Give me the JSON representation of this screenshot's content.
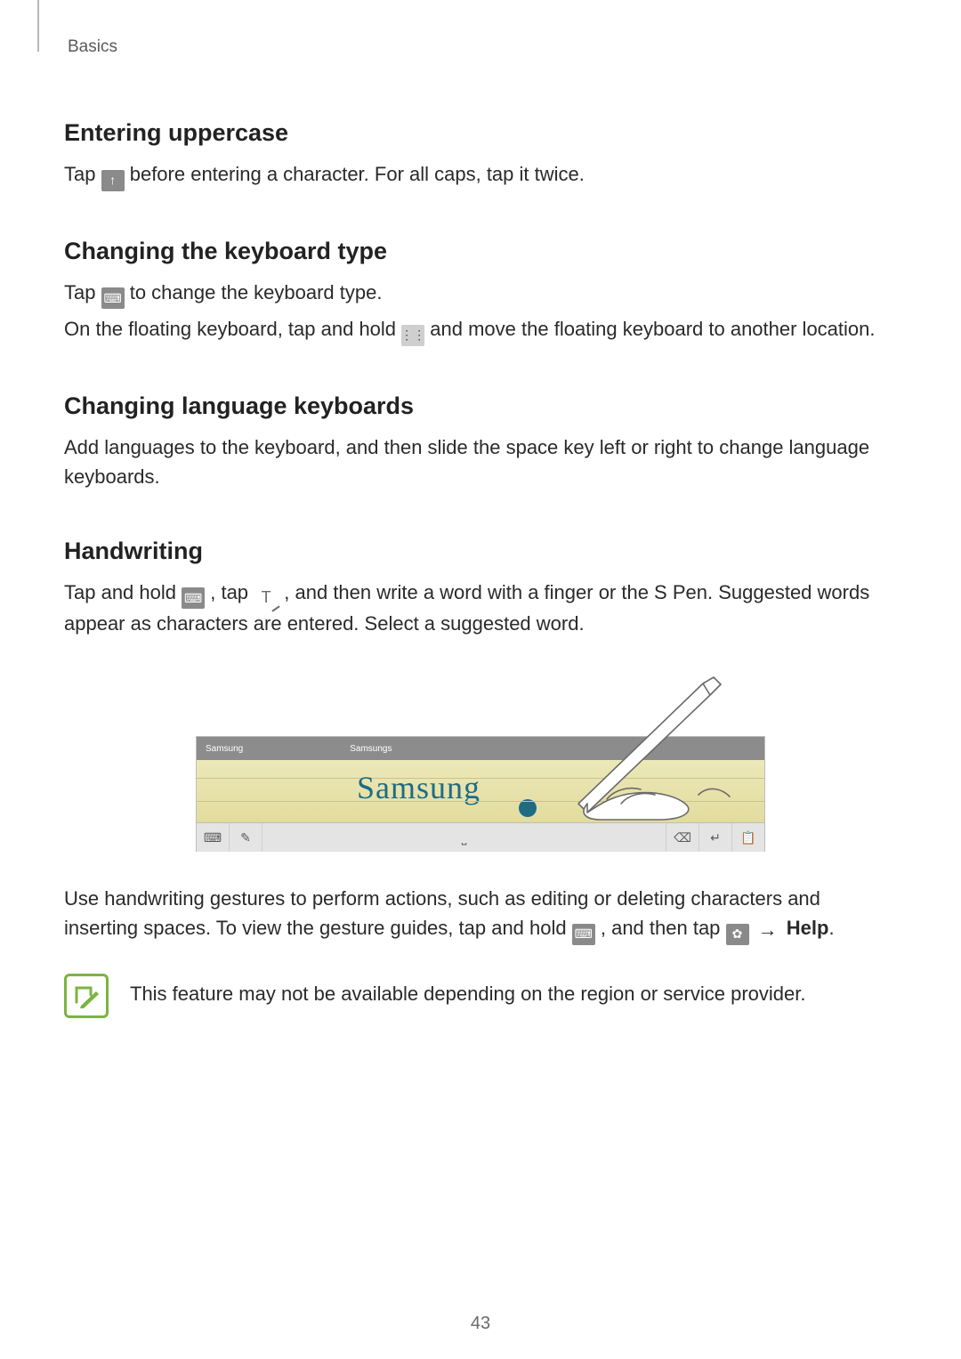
{
  "breadcrumb": "Basics",
  "sections": {
    "uppercase": {
      "title": "Entering uppercase",
      "p1a": "Tap ",
      "p1b": " before entering a character. For all caps, tap it twice."
    },
    "kbdtype": {
      "title": "Changing the keyboard type",
      "p1a": "Tap ",
      "p1b": " to change the keyboard type.",
      "p2a": "On the floating keyboard, tap and hold ",
      "p2b": " and move the floating keyboard to another location."
    },
    "lang": {
      "title": "Changing language keyboards",
      "p1": "Add languages to the keyboard, and then slide the space key left or right to change language keyboards."
    },
    "handwriting": {
      "title": "Handwriting",
      "p1a": "Tap and hold ",
      "p1b": ", tap ",
      "p1c": ", and then write a word with a finger or the S Pen. Suggested words appear as characters are entered. Select a suggested word.",
      "p2a": "Use handwriting gestures to perform actions, such as editing or deleting characters and inserting spaces. To view the gesture guides, tap and hold ",
      "p2b": ", and then tap ",
      "arrow": "→",
      "help": "Help",
      "p2c": "."
    }
  },
  "figure": {
    "suggestion1": "Samsung",
    "suggestion2": "Samsungs",
    "handwritten": "Samsung"
  },
  "icons": {
    "shift": "↑",
    "keyboard": "⌨",
    "drag_tab": "⋮⋮",
    "t_pen": "T",
    "gear": "✿",
    "space": "⎵",
    "backspace": "⌫",
    "enter": "↵",
    "clip": "📋",
    "mode": "✎"
  },
  "note": "This feature may not be available depending on the region or service provider.",
  "page_number": "43"
}
